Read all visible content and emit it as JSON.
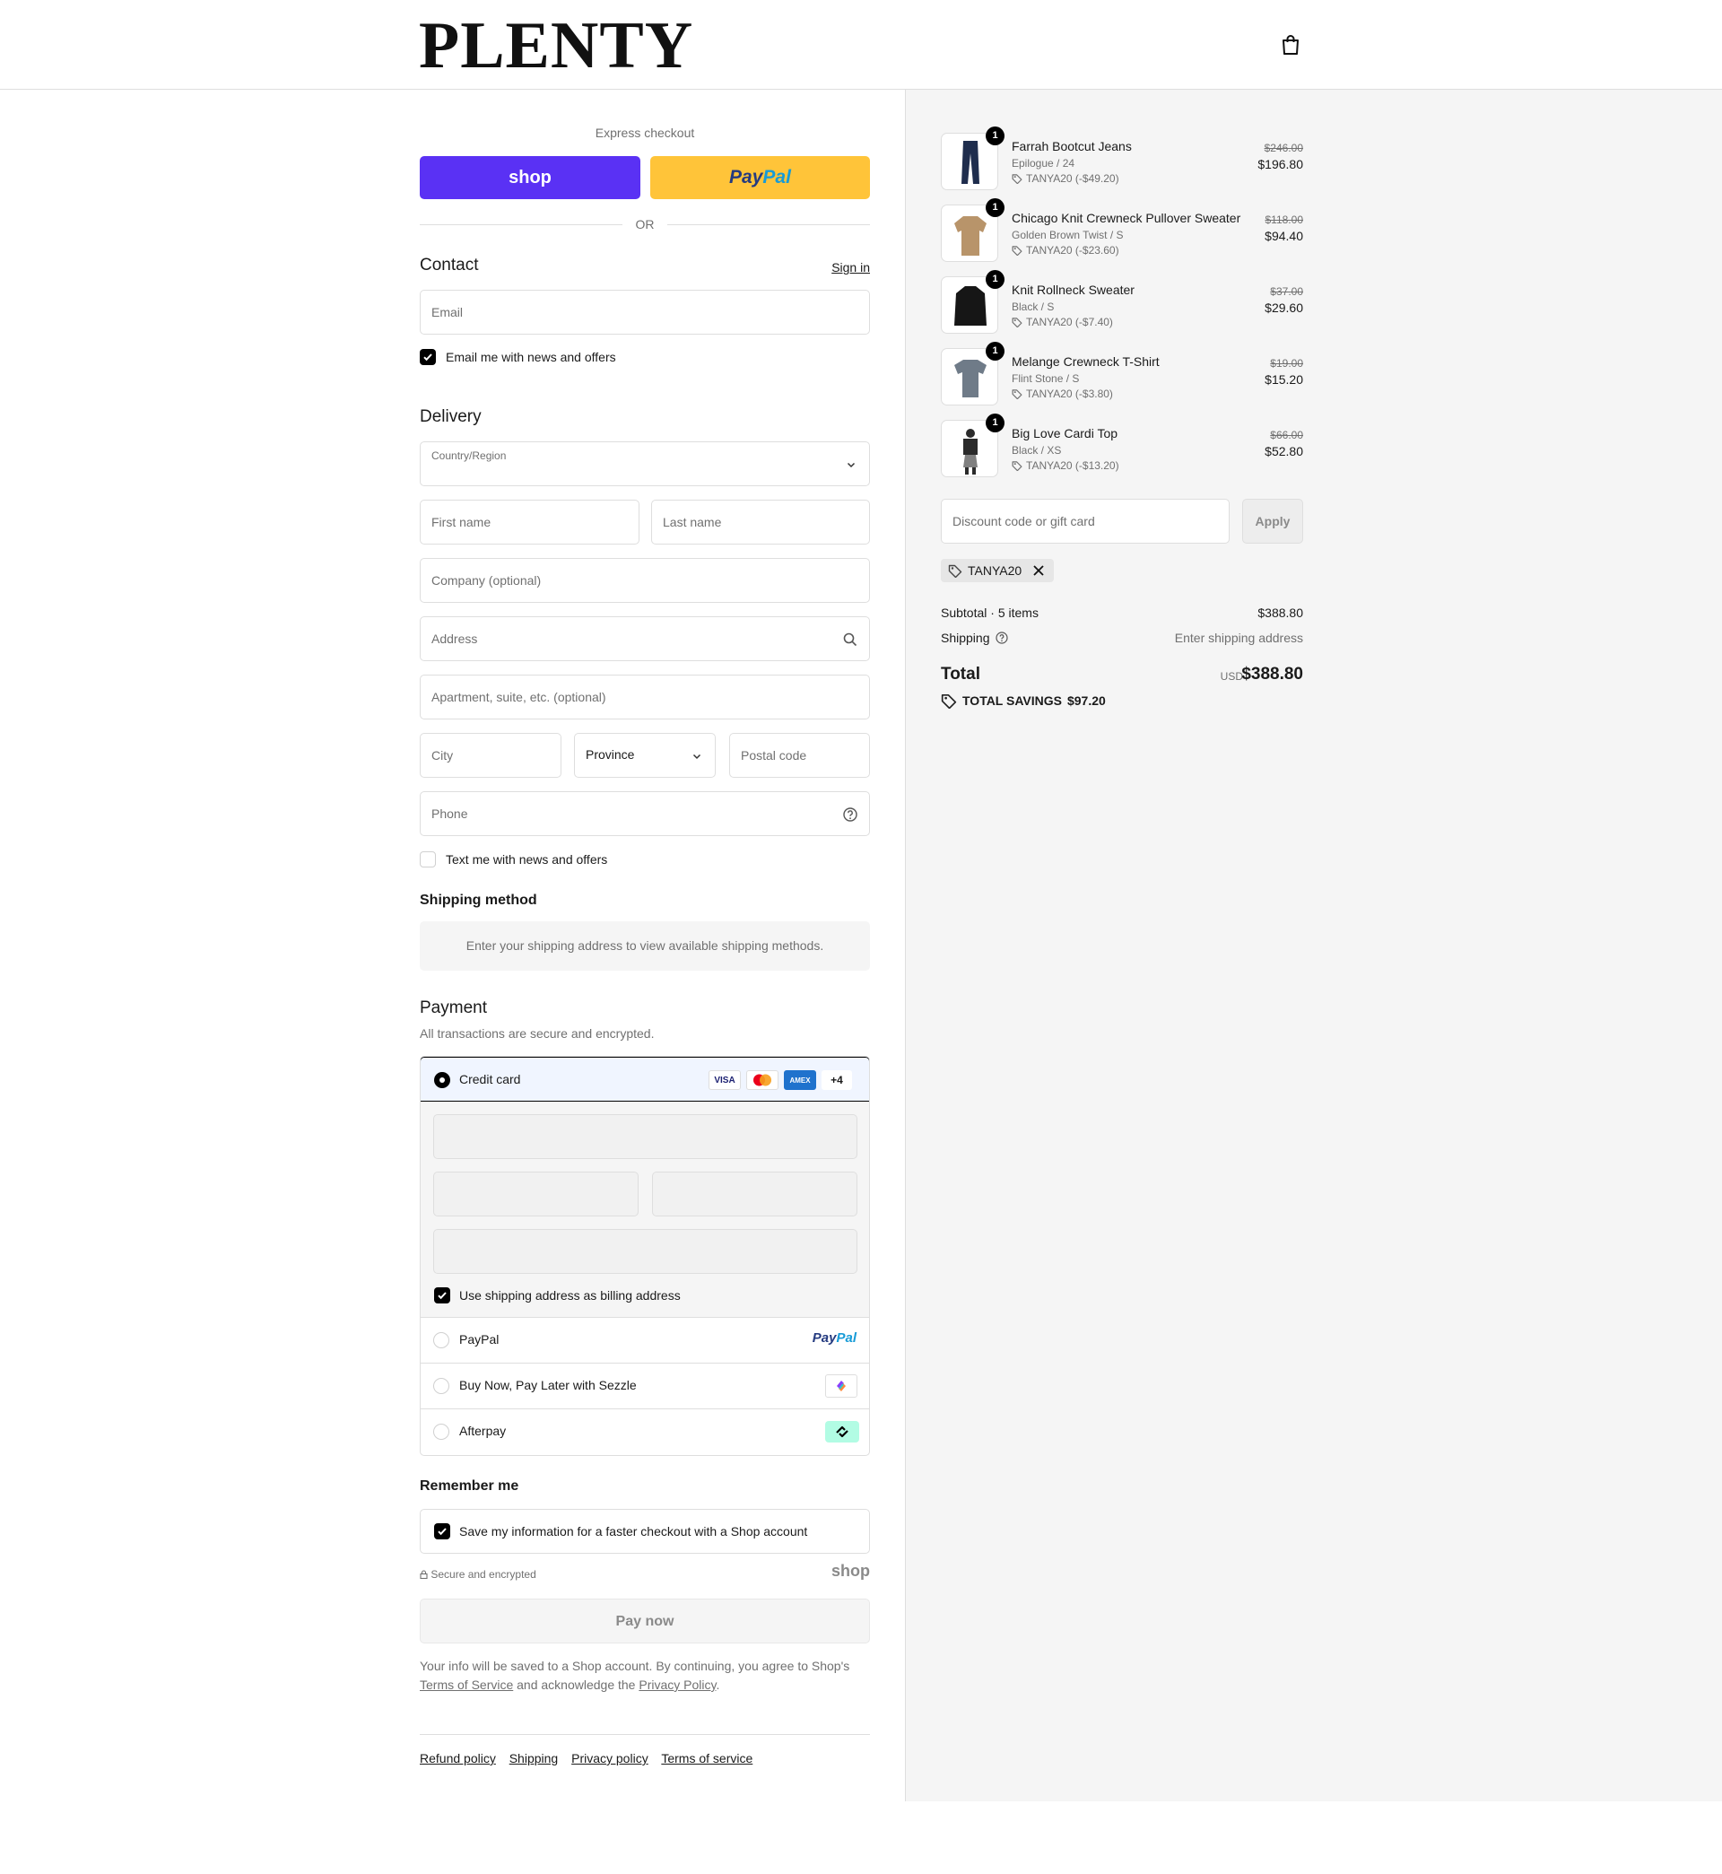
{
  "header": {
    "brand": "PLENTY"
  },
  "express": {
    "label": "Express checkout",
    "shop_label": "shop",
    "paypal_label_1": "Pay",
    "paypal_label_2": "Pal",
    "or_label": "OR"
  },
  "contact": {
    "title": "Contact",
    "sign_in": "Sign in",
    "email_placeholder": "Email",
    "news_label": "Email me with news and offers",
    "news_checked": true
  },
  "delivery": {
    "title": "Delivery",
    "country_label": "Country/Region",
    "first_name": "First name",
    "last_name": "Last name",
    "company": "Company (optional)",
    "address": "Address",
    "apartment": "Apartment, suite, etc. (optional)",
    "city": "City",
    "province": "Province",
    "postal": "Postal code",
    "phone": "Phone",
    "text_label": "Text me with news and offers",
    "text_checked": false
  },
  "shipping": {
    "title": "Shipping method",
    "info": "Enter your shipping address to view available shipping methods."
  },
  "payment": {
    "title": "Payment",
    "subtitle": "All transactions are secure and encrypted.",
    "credit_label": "Credit card",
    "cards": [
      "VISA",
      "MC",
      "AMEX",
      "+4"
    ],
    "billing_label": "Use shipping address as billing address",
    "paypal_label": "PayPal",
    "paypal_logo_1": "Pay",
    "paypal_logo_2": "Pal",
    "sezzle_label": "Buy Now, Pay Later with Sezzle",
    "afterpay_label": "Afterpay"
  },
  "remember": {
    "title": "Remember me",
    "save_label": "Save my information for a faster checkout with a Shop account"
  },
  "secure_label": "Secure and encrypted",
  "shop_mark": "shop",
  "pay_now": "Pay now",
  "legal": {
    "text_1": "Your info will be saved to a Shop account. By continuing, you agree to Shop's",
    "terms": "Terms of Service",
    "text_2": "and acknowledge the",
    "privacy": "Privacy Policy",
    "text_3": "."
  },
  "footer": [
    "Refund policy",
    "Shipping",
    "Privacy policy",
    "Terms of service"
  ],
  "cart": {
    "items": [
      {
        "name": "Farrah Bootcut Jeans",
        "variant": "Epilogue / 24",
        "discount": "TANYA20 (-$49.20)",
        "old_price": "$246.00",
        "price": "$196.80",
        "qty": "1",
        "color": "#1f2d4d"
      },
      {
        "name": "Chicago Knit Crewneck Pullover Sweater",
        "variant": "Golden Brown Twist / S",
        "discount": "TANYA20 (-$23.60)",
        "old_price": "$118.00",
        "price": "$94.40",
        "qty": "1",
        "color": "#b8946a"
      },
      {
        "name": "Knit Rollneck Sweater",
        "variant": "Black / S",
        "discount": "TANYA20 (-$7.40)",
        "old_price": "$37.00",
        "price": "$29.60",
        "qty": "1",
        "color": "#161616"
      },
      {
        "name": "Melange Crewneck T-Shirt",
        "variant": "Flint Stone / S",
        "discount": "TANYA20 (-$3.80)",
        "old_price": "$19.00",
        "price": "$15.20",
        "qty": "1",
        "color": "#6f7b88"
      },
      {
        "name": "Big Love Cardi Top",
        "variant": "Black / XS",
        "discount": "TANYA20 (-$13.20)",
        "old_price": "$66.00",
        "price": "$52.80",
        "qty": "1",
        "color": "#2b2b2b"
      }
    ],
    "discount_placeholder": "Discount code or gift card",
    "apply": "Apply",
    "applied_code": "TANYA20",
    "subtotal_label": "Subtotal · 5 items",
    "subtotal": "$388.80",
    "shipping_label": "Shipping",
    "shipping_value": "Enter shipping address",
    "total_label": "Total",
    "currency": "USD",
    "total": "$388.80",
    "savings_label": "TOTAL SAVINGS",
    "savings": "$97.20"
  }
}
